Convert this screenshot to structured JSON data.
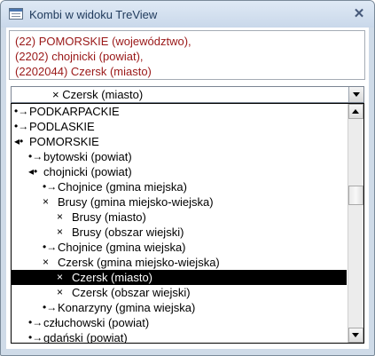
{
  "window": {
    "title": "Kombi w widoku TreView",
    "close_glyph": "✕"
  },
  "info": {
    "lines": [
      "(22) POMORSKIE (województwo),",
      "(2202) chojnicki  (powiat),",
      "(2202044) Czersk (miasto)"
    ],
    "text_color": "#9a1818"
  },
  "combo": {
    "marker": "×",
    "value": "Czersk (miasto)"
  },
  "tree": {
    "selected_index": 11,
    "items": [
      {
        "marker": "•→",
        "label": "PODKARPACKIE",
        "level": 0,
        "state": "collapsed"
      },
      {
        "marker": "•→",
        "label": "PODLASKIE",
        "level": 0,
        "state": "collapsed"
      },
      {
        "marker": "◂•",
        "label": "POMORSKIE",
        "level": 0,
        "state": "expanded"
      },
      {
        "marker": "•→",
        "label": "bytowski (powiat)",
        "level": 1,
        "state": "collapsed"
      },
      {
        "marker": "◂•",
        "label": "chojnicki (powiat)",
        "level": 1,
        "state": "expanded"
      },
      {
        "marker": "•→",
        "label": "Chojnice (gmina miejska)",
        "level": 2,
        "state": "collapsed"
      },
      {
        "marker": "×",
        "label": "Brusy (gmina miejsko-wiejska)",
        "level": 2,
        "state": "leaf"
      },
      {
        "marker": "×",
        "label": "Brusy (miasto)",
        "level": 3,
        "state": "leaf"
      },
      {
        "marker": "×",
        "label": "Brusy (obszar wiejski)",
        "level": 3,
        "state": "leaf"
      },
      {
        "marker": "•→",
        "label": "Chojnice (gmina wiejska)",
        "level": 2,
        "state": "collapsed"
      },
      {
        "marker": "×",
        "label": "Czersk (gmina miejsko-wiejska)",
        "level": 2,
        "state": "leaf"
      },
      {
        "marker": "×",
        "label": "Czersk (miasto)",
        "level": 3,
        "state": "leaf"
      },
      {
        "marker": "×",
        "label": "Czersk (obszar wiejski)",
        "level": 3,
        "state": "leaf"
      },
      {
        "marker": "•→",
        "label": "Konarzyny (gmina wiejska)",
        "level": 2,
        "state": "collapsed"
      },
      {
        "marker": "•→",
        "label": "człuchowski (powiat)",
        "level": 1,
        "state": "collapsed"
      },
      {
        "marker": "•→",
        "label": "gdański (powiat)",
        "level": 1,
        "state": "collapsed"
      }
    ]
  },
  "scrollbar": {
    "position_fraction": 0.35
  },
  "icons": {
    "app": "form-window-icon",
    "close": "close-icon",
    "dropdown": "chevron-down-icon",
    "scroll_up": "arrow-up-icon",
    "scroll_down": "arrow-down-icon"
  }
}
